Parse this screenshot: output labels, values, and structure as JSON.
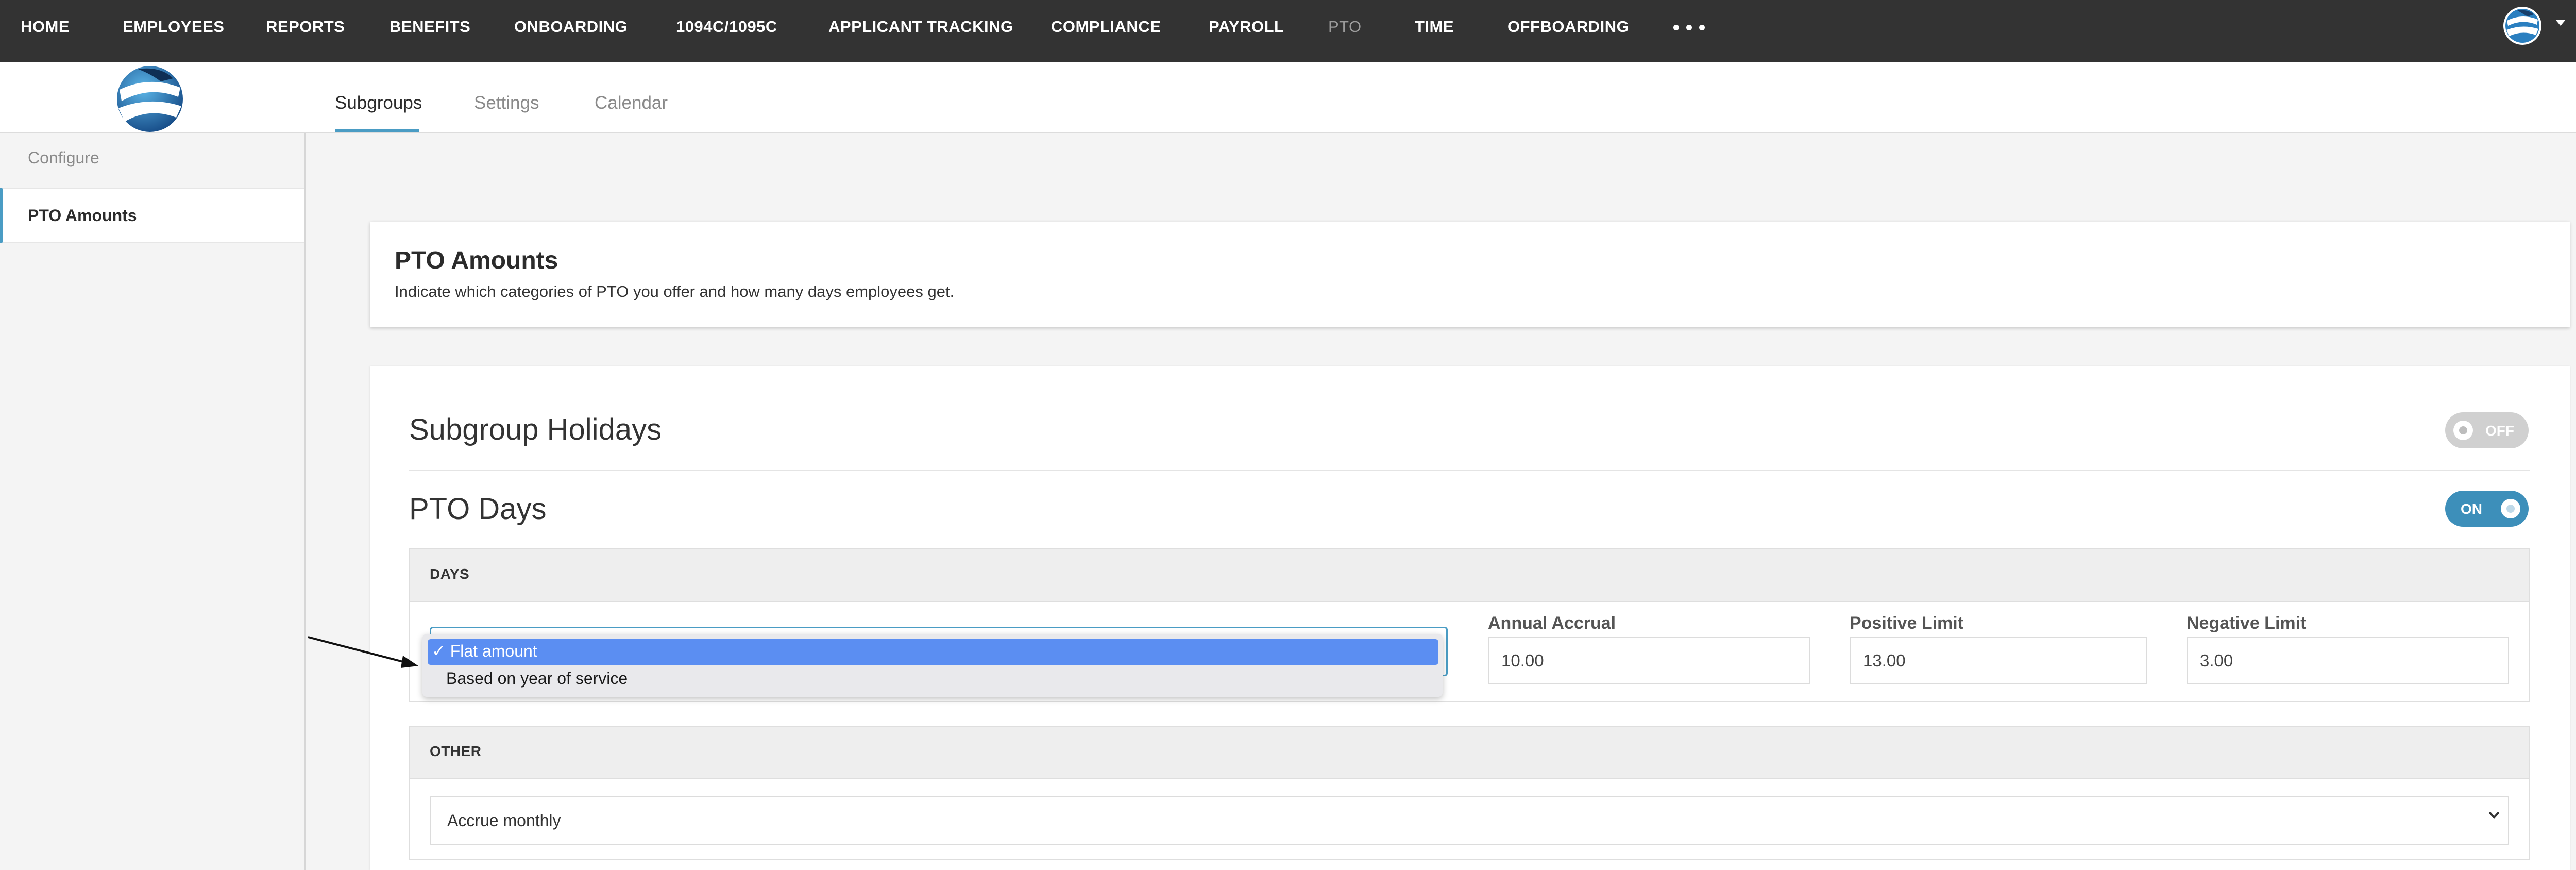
{
  "nav": {
    "items": [
      "HOME",
      "EMPLOYEES",
      "REPORTS",
      "BENEFITS",
      "ONBOARDING",
      "1094C/1095C",
      "APPLICANT TRACKING",
      "COMPLIANCE",
      "PAYROLL",
      "PTO",
      "TIME",
      "OFFBOARDING"
    ],
    "active": "PTO"
  },
  "tabs": [
    "Subgroups",
    "Settings",
    "Calendar"
  ],
  "sidebar": {
    "section": "Configure",
    "item": "PTO Amounts"
  },
  "header": {
    "title": "PTO Amounts",
    "description": "Indicate which categories of PTO you offer and how many days employees get."
  },
  "holidays": {
    "title": "Subgroup Holidays",
    "toggle_label": "OFF"
  },
  "pto_days": {
    "title": "PTO Days",
    "toggle_label": "ON"
  },
  "days_panel": {
    "label": "DAYS",
    "dropdown_options": [
      "✓ Flat amount",
      "Based on year of service"
    ],
    "annual_accrual_label": "Annual Accrual",
    "annual_accrual_value": "10.00",
    "positive_limit_label": "Positive Limit",
    "positive_limit_value": "13.00",
    "negative_limit_label": "Negative Limit",
    "negative_limit_value": "3.00"
  },
  "other_panel": {
    "label": "OTHER",
    "select_value": "Accrue monthly"
  },
  "colors": {
    "nav_bg": "#333333",
    "accent": "#4a9cc4",
    "toggle_on": "#3d8fba",
    "selected_option": "#5b8ef2"
  }
}
